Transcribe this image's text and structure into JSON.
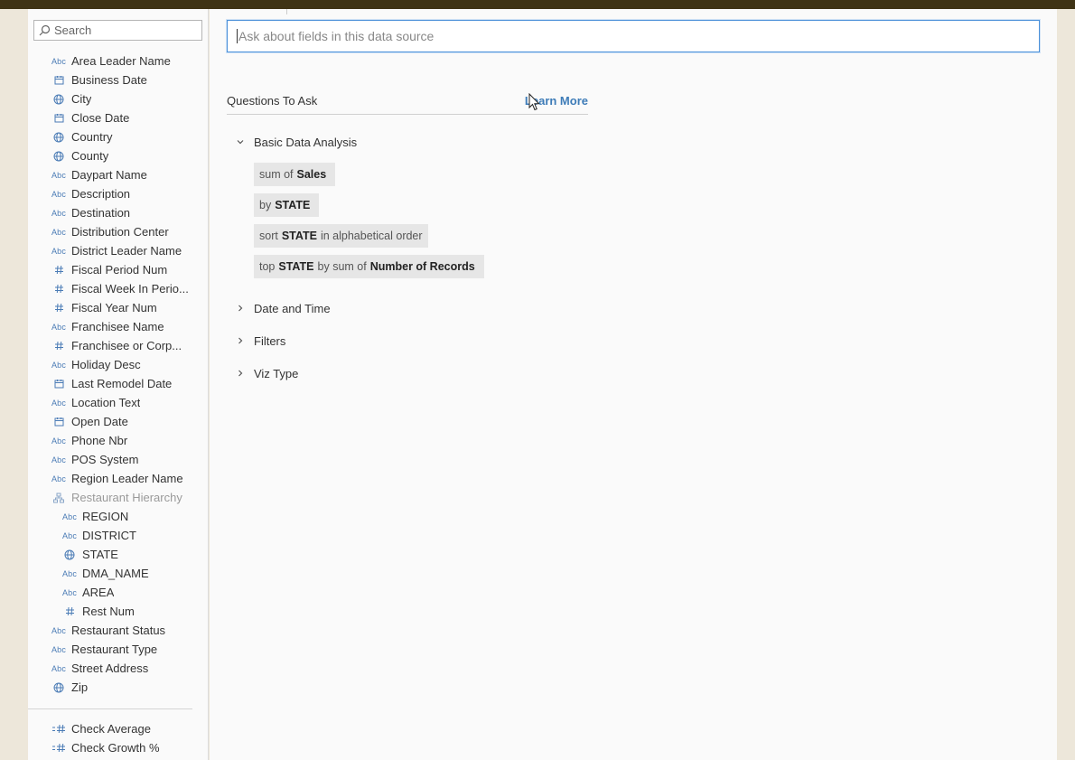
{
  "sidebar": {
    "search_placeholder": "Search",
    "fields": [
      {
        "type": "abc",
        "label": "Area Leader Name"
      },
      {
        "type": "date",
        "label": "Business Date"
      },
      {
        "type": "geo",
        "label": "City"
      },
      {
        "type": "date",
        "label": "Close Date"
      },
      {
        "type": "geo",
        "label": "Country"
      },
      {
        "type": "geo",
        "label": "County"
      },
      {
        "type": "abc",
        "label": "Daypart Name"
      },
      {
        "type": "abc",
        "label": "Description"
      },
      {
        "type": "abc",
        "label": "Destination"
      },
      {
        "type": "abc",
        "label": "Distribution Center"
      },
      {
        "type": "abc",
        "label": "District Leader Name"
      },
      {
        "type": "num",
        "label": "Fiscal Period Num"
      },
      {
        "type": "num",
        "label": "Fiscal Week In Perio..."
      },
      {
        "type": "num",
        "label": "Fiscal Year Num"
      },
      {
        "type": "abc",
        "label": "Franchisee Name"
      },
      {
        "type": "num",
        "label": "Franchisee or Corp..."
      },
      {
        "type": "abc",
        "label": "Holiday Desc"
      },
      {
        "type": "date",
        "label": "Last Remodel Date"
      },
      {
        "type": "abc",
        "label": "Location Text"
      },
      {
        "type": "date",
        "label": "Open Date"
      },
      {
        "type": "abc",
        "label": "Phone Nbr"
      },
      {
        "type": "abc",
        "label": "POS System"
      },
      {
        "type": "abc",
        "label": "Region Leader Name"
      },
      {
        "type": "hier",
        "label": "Restaurant Hierarchy"
      },
      {
        "type": "abc",
        "label": "REGION",
        "child": true
      },
      {
        "type": "abc",
        "label": "DISTRICT",
        "child": true
      },
      {
        "type": "geo",
        "label": "STATE",
        "child": true
      },
      {
        "type": "abc",
        "label": "DMA_NAME",
        "child": true
      },
      {
        "type": "abc",
        "label": "AREA",
        "child": true
      },
      {
        "type": "num",
        "label": "Rest Num",
        "child": true
      },
      {
        "type": "abc",
        "label": "Restaurant Status"
      },
      {
        "type": "abc",
        "label": "Restaurant Type"
      },
      {
        "type": "abc",
        "label": "Street Address"
      },
      {
        "type": "geo",
        "label": "Zip"
      }
    ],
    "measures": [
      {
        "type": "measure",
        "label": "Check Average"
      },
      {
        "type": "measure",
        "label": "Check Growth %"
      }
    ]
  },
  "main": {
    "ask_placeholder": "Ask about fields in this data source",
    "questions_title": "Questions To Ask",
    "learn_more": "Learn More",
    "sections": [
      {
        "label": "Basic Data Analysis",
        "expanded": true
      },
      {
        "label": "Date and Time",
        "expanded": false
      },
      {
        "label": "Filters",
        "expanded": false
      },
      {
        "label": "Viz Type",
        "expanded": false
      }
    ],
    "chips": [
      [
        {
          "t": "sum of",
          "b": false
        },
        {
          "t": "Sales",
          "b": true
        }
      ],
      [
        {
          "t": "by",
          "b": false
        },
        {
          "t": "STATE",
          "b": true
        }
      ],
      [
        {
          "t": "sort",
          "b": false
        },
        {
          "t": "STATE",
          "b": true
        },
        {
          "t": "in alphabetical order",
          "b": false
        }
      ],
      [
        {
          "t": "top",
          "b": false
        },
        {
          "t": "STATE",
          "b": true
        },
        {
          "t": "by sum of",
          "b": false
        },
        {
          "t": "Number of Records",
          "b": true
        }
      ]
    ]
  },
  "icons": {
    "abc": "abc-icon",
    "date": "calendar-icon",
    "geo": "globe-icon",
    "num": "hash-icon",
    "hier": "hierarchy-icon",
    "measure": "measure-hash-icon"
  },
  "colors": {
    "accent": "#3e7cb8",
    "icon": "#4a7bb5",
    "topbar": "#3f3315",
    "chip": "#e6e6e6"
  }
}
